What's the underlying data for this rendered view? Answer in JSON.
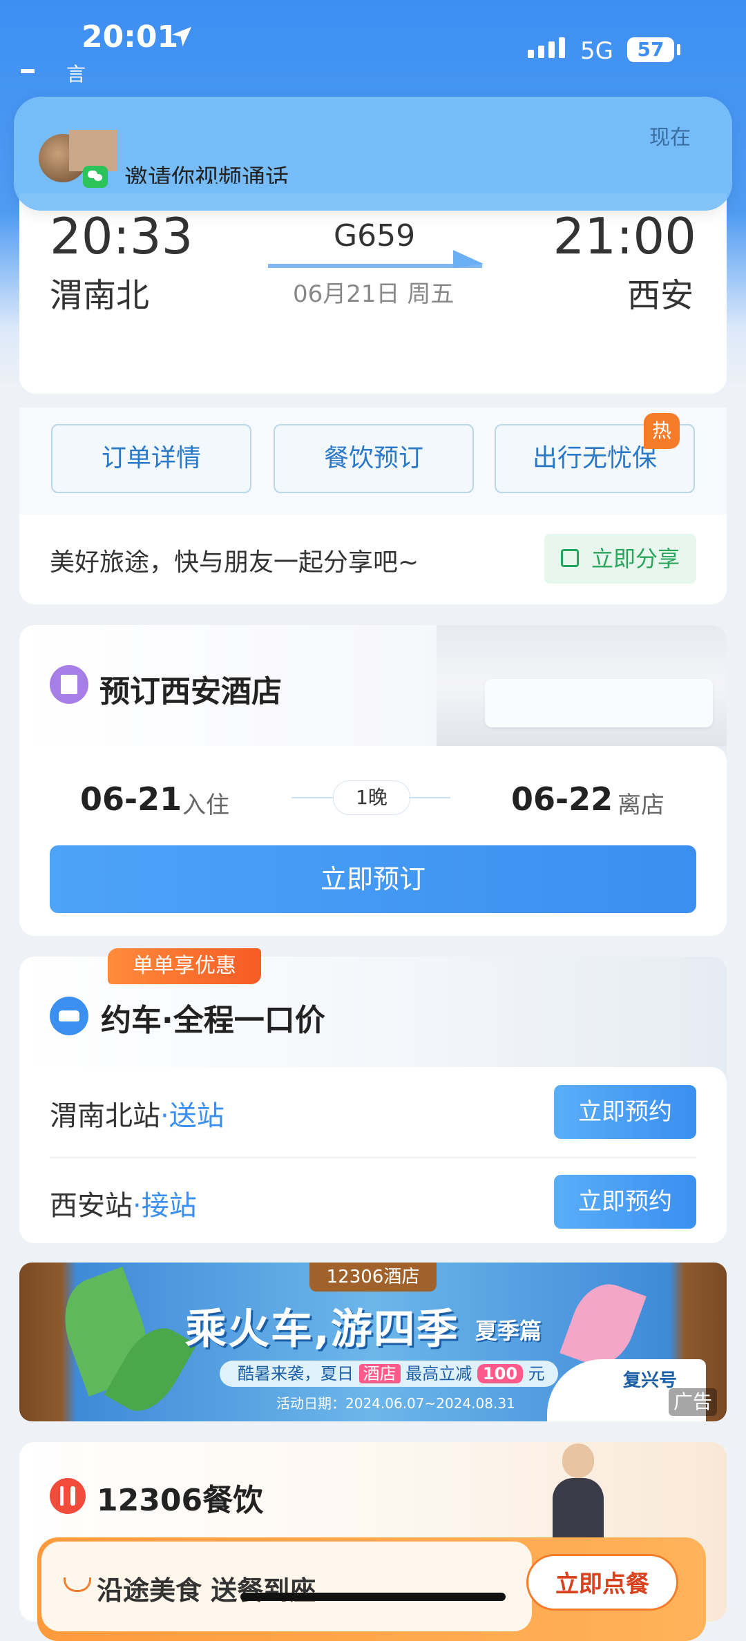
{
  "status_bar": {
    "time": "20:01",
    "network": "5G",
    "battery": "57",
    "back_label": "言"
  },
  "notification": {
    "text": "邀请你视频通话",
    "time": "现在"
  },
  "trip": {
    "departure_time": "20:33",
    "departure_station": "渭南北",
    "train_number": "G659",
    "date": "06月21日 周五",
    "arrival_time": "21:00",
    "arrival_station": "西安"
  },
  "actions": {
    "order_details": "订单详情",
    "dining_booking": "餐饮预订",
    "travel_insurance": "出行无忧保",
    "hot_badge": "热"
  },
  "share": {
    "text": "美好旅途，快与朋友一起分享吧~",
    "button": "立即分享"
  },
  "hotel": {
    "title": "预订西安酒店",
    "checkin_date": "06-21",
    "checkin_label": "入住",
    "nights": "1晚",
    "checkout_date": "06-22",
    "checkout_label": "离店",
    "book_button": "立即预订"
  },
  "car": {
    "promo_badge": "单单享优惠",
    "title": "约车·全程一口价",
    "rows": [
      {
        "station": "渭南北站",
        "tag": "·送站",
        "button": "立即预约"
      },
      {
        "station": "西安站",
        "tag": "·接站",
        "button": "立即预约"
      }
    ]
  },
  "banner": {
    "tag": "12306酒店",
    "title": "乘火车,游四季",
    "subtitle": "夏季篇",
    "strip_prefix": "酷暑来袭，夏日",
    "strip_hotel": "酒店",
    "strip_mid": "最高立减",
    "strip_amount": "100",
    "strip_unit": "元",
    "date": "活动日期：2024.06.07~2024.08.31",
    "train_label": "复兴号",
    "ad_label": "广告"
  },
  "dining": {
    "title": "12306餐饮",
    "text": "沿途美食  送餐到座",
    "button": "立即点餐"
  },
  "colors": {
    "accent": "#3b8ff0",
    "hot": "#f57c2a",
    "share_green": "#2aa55c",
    "dining_red": "#f04b3b"
  }
}
